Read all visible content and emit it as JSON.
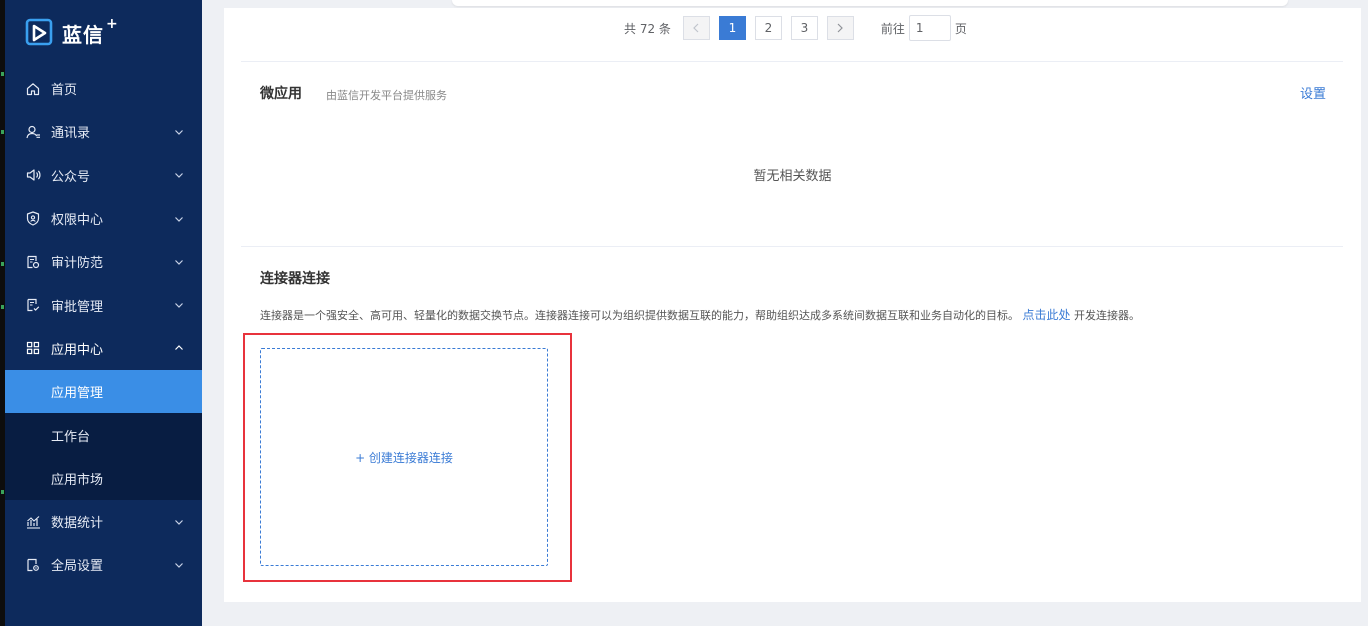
{
  "brand": {
    "name": "蓝信",
    "plus": "+"
  },
  "sidebar": {
    "items": [
      {
        "label": "首页",
        "icon": "home-icon"
      },
      {
        "label": "通讯录",
        "icon": "contacts-icon",
        "expandable": true
      },
      {
        "label": "公众号",
        "icon": "speaker-icon",
        "expandable": true
      },
      {
        "label": "权限中心",
        "icon": "shield-icon",
        "expandable": true
      },
      {
        "label": "审计防范",
        "icon": "audit-icon",
        "expandable": true
      },
      {
        "label": "审批管理",
        "icon": "approval-icon",
        "expandable": true
      },
      {
        "label": "应用中心",
        "icon": "grid-icon",
        "expandable": true,
        "expanded": true
      },
      {
        "label": "数据统计",
        "icon": "chart-icon",
        "expandable": true
      },
      {
        "label": "全局设置",
        "icon": "settings-icon",
        "expandable": true
      }
    ],
    "app_center_children": [
      {
        "label": "应用管理",
        "active": true
      },
      {
        "label": "工作台"
      },
      {
        "label": "应用市场"
      }
    ]
  },
  "pagination": {
    "total_label": "共 72 条",
    "pages": [
      "1",
      "2",
      "3"
    ],
    "current_page": "1",
    "goto_prefix": "前往",
    "goto_value": "1",
    "goto_suffix": "页"
  },
  "micro_apps": {
    "title": "微应用",
    "subtitle": "由蓝信开发平台提供服务",
    "settings_label": "设置",
    "empty_text": "暂无相关数据"
  },
  "connector": {
    "title": "连接器连接",
    "description": "连接器是一个强安全、高可用、轻量化的数据交换节点。连接器连接可以为组织提供数据互联的能力，帮助组织达成多系统间数据互联和业务自动化的目标。",
    "link_label": "点击此处",
    "link_suffix": "开发连接器。",
    "create_label": "+ 创建连接器连接"
  },
  "colors": {
    "sidebar_bg": "#0d2a5c",
    "active_item_bg": "#3a8ee6",
    "link_blue": "#3a7bd5",
    "highlight_red": "#e8333c"
  }
}
